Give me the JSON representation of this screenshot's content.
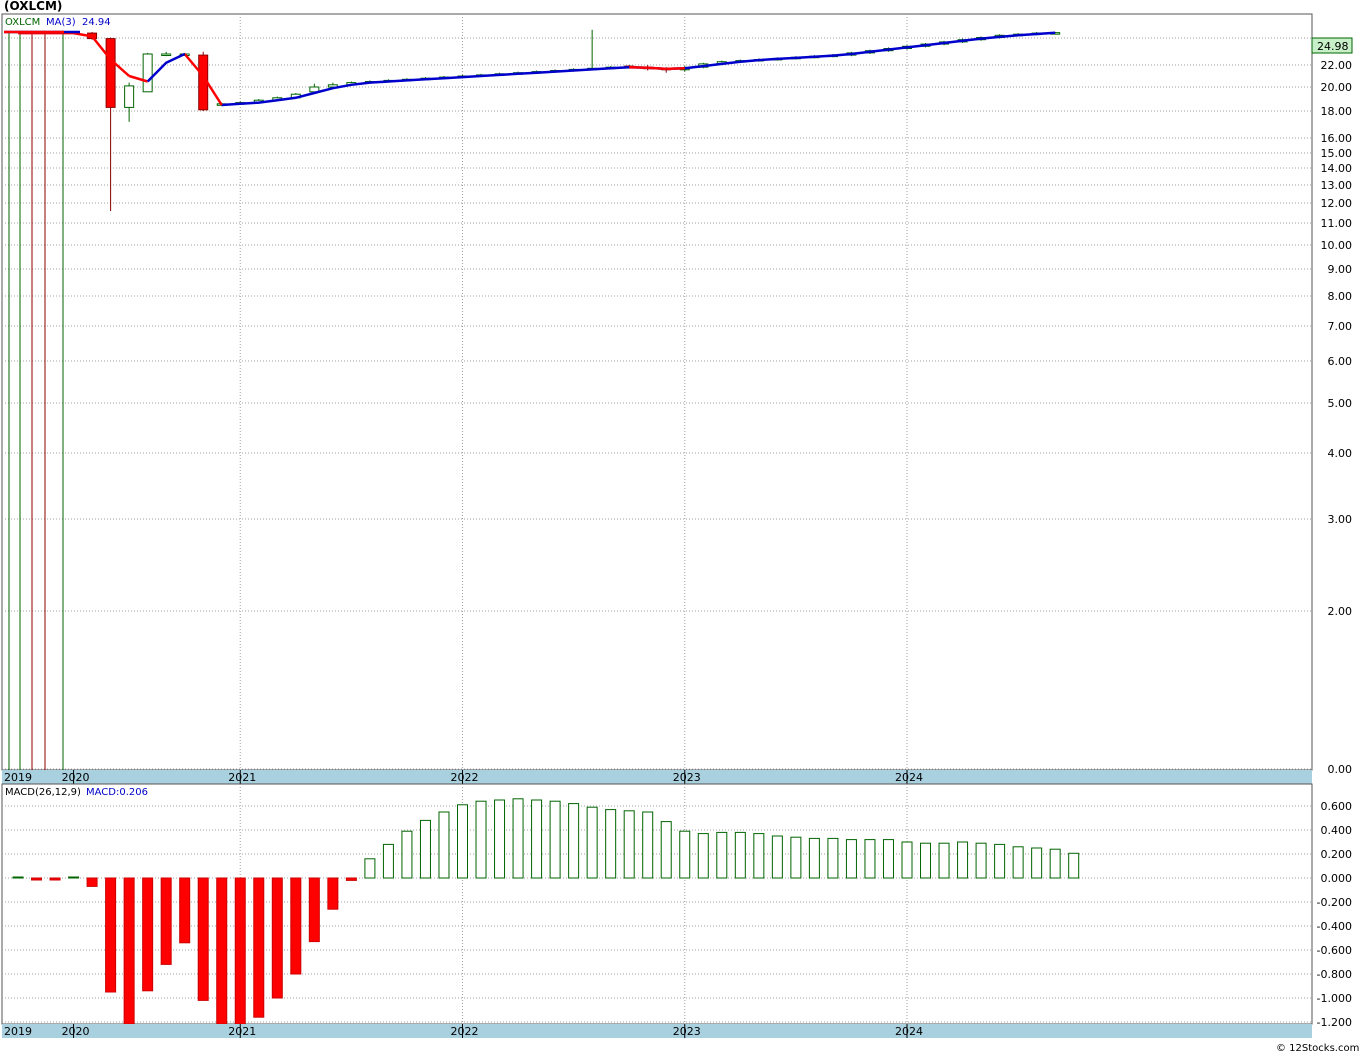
{
  "title": "(OXLCM)",
  "footer": "© 12Stocks.com",
  "chart_data": [
    {
      "type": "candlestick",
      "panel": "price",
      "symbol_label": "OXLCM",
      "ma_label": "MA(3)",
      "ma_value_label": "24.94",
      "last_price_label": "24.98",
      "y_scale": "log",
      "ylim": [
        0,
        25
      ],
      "y_ticks": [
        "22.00",
        "20.00",
        "18.00",
        "16.00",
        "15.00",
        "14.00",
        "13.00",
        "12.00",
        "11.00",
        "10.00",
        "9.00",
        "8.00",
        "7.00",
        "6.00",
        "5.00",
        "4.00",
        "3.00",
        "2.00",
        "0.00"
      ],
      "x_labels": [
        "2019",
        "2020",
        "2021",
        "2022",
        "2023",
        "2024"
      ],
      "x_label_months": [
        0,
        3,
        12,
        24,
        36,
        48
      ],
      "grid": true,
      "colors": {
        "up": "#006400",
        "down": "#ff0000",
        "ma_up": "#0000cc",
        "ma_down": "#ff0000",
        "grid": "#a0a0a0",
        "axis_band": "#a9d0df",
        "last_price_box": "#c8f0c8"
      },
      "candles": [
        {
          "m": 0,
          "o": 24.9,
          "h": 25.0,
          "l": 24.8,
          "c": 24.9
        },
        {
          "m": 1,
          "o": 24.9,
          "h": 25.0,
          "l": 24.8,
          "c": 24.95
        },
        {
          "m": 2,
          "o": 24.9,
          "h": 25.0,
          "l": 24.8,
          "c": 24.9
        },
        {
          "m": 3,
          "o": 24.9,
          "h": 25.0,
          "l": 24.8,
          "c": 24.95
        },
        {
          "m": 4,
          "o": 24.9,
          "h": 25.0,
          "l": 24.3,
          "c": 24.4
        },
        {
          "m": 5,
          "o": 24.4,
          "h": 24.5,
          "l": 11.6,
          "c": 18.3
        },
        {
          "m": 6,
          "o": 18.3,
          "h": 20.4,
          "l": 17.2,
          "c": 20.1
        },
        {
          "m": 7,
          "o": 19.6,
          "h": 23.1,
          "l": 19.6,
          "c": 23.0
        },
        {
          "m": 8,
          "o": 23.0,
          "h": 23.2,
          "l": 22.8,
          "c": 23.0
        },
        {
          "m": 9,
          "o": 23.0,
          "h": 23.1,
          "l": 22.9,
          "c": 23.0
        },
        {
          "m": 10,
          "o": 22.9,
          "h": 23.2,
          "l": 18.0,
          "c": 18.1
        },
        {
          "m": 11,
          "o": 18.5,
          "h": 18.7,
          "l": 18.4,
          "c": 18.6
        },
        {
          "m": 12,
          "o": 18.6,
          "h": 18.8,
          "l": 18.5,
          "c": 18.7
        },
        {
          "m": 13,
          "o": 18.7,
          "h": 19.0,
          "l": 18.6,
          "c": 18.9
        },
        {
          "m": 14,
          "o": 18.9,
          "h": 19.2,
          "l": 18.8,
          "c": 19.1
        },
        {
          "m": 15,
          "o": 19.1,
          "h": 19.5,
          "l": 19.0,
          "c": 19.4
        },
        {
          "m": 16,
          "o": 19.6,
          "h": 20.3,
          "l": 19.5,
          "c": 20.0
        },
        {
          "m": 17,
          "o": 20.0,
          "h": 20.4,
          "l": 19.9,
          "c": 20.2
        },
        {
          "m": 18,
          "o": 20.2,
          "h": 20.5,
          "l": 20.1,
          "c": 20.4
        },
        {
          "m": 19,
          "o": 20.4,
          "h": 20.6,
          "l": 20.3,
          "c": 20.5
        },
        {
          "m": 20,
          "o": 20.5,
          "h": 20.7,
          "l": 20.4,
          "c": 20.6
        },
        {
          "m": 21,
          "o": 20.6,
          "h": 20.8,
          "l": 20.5,
          "c": 20.7
        },
        {
          "m": 22,
          "o": 20.7,
          "h": 20.9,
          "l": 20.6,
          "c": 20.8
        },
        {
          "m": 23,
          "o": 20.8,
          "h": 21.0,
          "l": 20.7,
          "c": 20.9
        },
        {
          "m": 24,
          "o": 20.9,
          "h": 21.1,
          "l": 20.8,
          "c": 21.0
        },
        {
          "m": 25,
          "o": 21.0,
          "h": 21.2,
          "l": 20.9,
          "c": 21.1
        },
        {
          "m": 26,
          "o": 21.1,
          "h": 21.3,
          "l": 21.0,
          "c": 21.2
        },
        {
          "m": 27,
          "o": 21.2,
          "h": 21.4,
          "l": 21.1,
          "c": 21.3
        },
        {
          "m": 28,
          "o": 21.3,
          "h": 21.5,
          "l": 21.2,
          "c": 21.4
        },
        {
          "m": 29,
          "o": 21.4,
          "h": 21.6,
          "l": 21.3,
          "c": 21.5
        },
        {
          "m": 30,
          "o": 21.5,
          "h": 21.7,
          "l": 21.4,
          "c": 21.6
        },
        {
          "m": 31,
          "o": 21.6,
          "h": 25.2,
          "l": 21.5,
          "c": 21.7
        },
        {
          "m": 32,
          "o": 21.7,
          "h": 21.9,
          "l": 21.6,
          "c": 21.8
        },
        {
          "m": 33,
          "o": 21.9,
          "h": 22.0,
          "l": 21.7,
          "c": 21.8
        },
        {
          "m": 34,
          "o": 21.8,
          "h": 22.0,
          "l": 21.5,
          "c": 21.7
        },
        {
          "m": 35,
          "o": 21.7,
          "h": 21.8,
          "l": 21.3,
          "c": 21.6
        },
        {
          "m": 36,
          "o": 21.6,
          "h": 21.9,
          "l": 21.4,
          "c": 21.7
        },
        {
          "m": 37,
          "o": 21.8,
          "h": 22.2,
          "l": 21.7,
          "c": 22.1
        },
        {
          "m": 38,
          "o": 22.1,
          "h": 22.4,
          "l": 22.0,
          "c": 22.3
        },
        {
          "m": 39,
          "o": 22.3,
          "h": 22.5,
          "l": 22.2,
          "c": 22.4
        },
        {
          "m": 40,
          "o": 22.4,
          "h": 22.6,
          "l": 22.3,
          "c": 22.5
        },
        {
          "m": 41,
          "o": 22.5,
          "h": 22.7,
          "l": 22.4,
          "c": 22.6
        },
        {
          "m": 42,
          "o": 22.6,
          "h": 22.8,
          "l": 22.5,
          "c": 22.7
        },
        {
          "m": 43,
          "o": 22.7,
          "h": 22.9,
          "l": 22.6,
          "c": 22.8
        },
        {
          "m": 44,
          "o": 22.8,
          "h": 23.0,
          "l": 22.7,
          "c": 22.9
        },
        {
          "m": 45,
          "o": 22.9,
          "h": 23.2,
          "l": 22.8,
          "c": 23.1
        },
        {
          "m": 46,
          "o": 23.1,
          "h": 23.4,
          "l": 23.0,
          "c": 23.3
        },
        {
          "m": 47,
          "o": 23.3,
          "h": 23.6,
          "l": 23.2,
          "c": 23.5
        },
        {
          "m": 48,
          "o": 23.5,
          "h": 23.8,
          "l": 23.4,
          "c": 23.7
        },
        {
          "m": 49,
          "o": 23.7,
          "h": 24.0,
          "l": 23.6,
          "c": 23.9
        },
        {
          "m": 50,
          "o": 23.9,
          "h": 24.2,
          "l": 23.8,
          "c": 24.1
        },
        {
          "m": 51,
          "o": 24.1,
          "h": 24.4,
          "l": 24.0,
          "c": 24.3
        },
        {
          "m": 52,
          "o": 24.3,
          "h": 24.6,
          "l": 24.2,
          "c": 24.5
        },
        {
          "m": 53,
          "o": 24.5,
          "h": 24.8,
          "l": 24.4,
          "c": 24.7
        },
        {
          "m": 54,
          "o": 24.7,
          "h": 24.9,
          "l": 24.6,
          "c": 24.8
        },
        {
          "m": 55,
          "o": 24.8,
          "h": 25.0,
          "l": 24.7,
          "c": 24.9
        },
        {
          "m": 56,
          "o": 24.9,
          "h": 25.0,
          "l": 24.8,
          "c": 24.94
        }
      ],
      "ma": [
        {
          "m": 0,
          "v": 24.9
        },
        {
          "m": 1,
          "v": 24.9
        },
        {
          "m": 2,
          "v": 24.9
        },
        {
          "m": 3,
          "v": 24.9
        },
        {
          "m": 4,
          "v": 24.6
        },
        {
          "m": 5,
          "v": 22.5
        },
        {
          "m": 6,
          "v": 21.0
        },
        {
          "m": 7,
          "v": 20.5
        },
        {
          "m": 8,
          "v": 22.2
        },
        {
          "m": 9,
          "v": 23.0
        },
        {
          "m": 10,
          "v": 21.0
        },
        {
          "m": 11,
          "v": 18.5
        },
        {
          "m": 12,
          "v": 18.6
        },
        {
          "m": 13,
          "v": 18.7
        },
        {
          "m": 14,
          "v": 18.9
        },
        {
          "m": 15,
          "v": 19.1
        },
        {
          "m": 16,
          "v": 19.5
        },
        {
          "m": 17,
          "v": 19.9
        },
        {
          "m": 18,
          "v": 20.2
        },
        {
          "m": 19,
          "v": 20.4
        },
        {
          "m": 20,
          "v": 20.5
        },
        {
          "m": 21,
          "v": 20.6
        },
        {
          "m": 22,
          "v": 20.7
        },
        {
          "m": 23,
          "v": 20.8
        },
        {
          "m": 24,
          "v": 20.9
        },
        {
          "m": 25,
          "v": 21.0
        },
        {
          "m": 26,
          "v": 21.1
        },
        {
          "m": 27,
          "v": 21.2
        },
        {
          "m": 28,
          "v": 21.3
        },
        {
          "m": 29,
          "v": 21.4
        },
        {
          "m": 30,
          "v": 21.5
        },
        {
          "m": 31,
          "v": 21.6
        },
        {
          "m": 32,
          "v": 21.7
        },
        {
          "m": 33,
          "v": 21.8
        },
        {
          "m": 34,
          "v": 21.75
        },
        {
          "m": 35,
          "v": 21.65
        },
        {
          "m": 36,
          "v": 21.7
        },
        {
          "m": 37,
          "v": 21.9
        },
        {
          "m": 38,
          "v": 22.1
        },
        {
          "m": 39,
          "v": 22.3
        },
        {
          "m": 40,
          "v": 22.45
        },
        {
          "m": 41,
          "v": 22.55
        },
        {
          "m": 42,
          "v": 22.65
        },
        {
          "m": 43,
          "v": 22.75
        },
        {
          "m": 44,
          "v": 22.85
        },
        {
          "m": 45,
          "v": 23.0
        },
        {
          "m": 46,
          "v": 23.2
        },
        {
          "m": 47,
          "v": 23.4
        },
        {
          "m": 48,
          "v": 23.6
        },
        {
          "m": 49,
          "v": 23.8
        },
        {
          "m": 50,
          "v": 24.0
        },
        {
          "m": 51,
          "v": 24.2
        },
        {
          "m": 52,
          "v": 24.4
        },
        {
          "m": 53,
          "v": 24.55
        },
        {
          "m": 54,
          "v": 24.7
        },
        {
          "m": 55,
          "v": 24.82
        },
        {
          "m": 56,
          "v": 24.94
        }
      ]
    },
    {
      "type": "bar",
      "panel": "macd",
      "label": "MACD(26,12,9)",
      "value_label": "MACD:0.206",
      "ylim": [
        -1.26,
        0.66
      ],
      "y_ticks": [
        "0.600",
        "0.400",
        "0.200",
        "0.000",
        "-0.200",
        "-0.400",
        "-0.600",
        "-0.800",
        "-1.000",
        "-1.200"
      ],
      "x_labels": [
        "2019",
        "2020",
        "2021",
        "2022",
        "2023",
        "2024"
      ],
      "x_label_months": [
        0,
        3,
        12,
        24,
        36,
        48
      ],
      "colors": {
        "positive": "#006400",
        "negative": "#ff0000"
      },
      "bars": [
        {
          "m": 0,
          "v": 0.0
        },
        {
          "m": 1,
          "v": -0.008
        },
        {
          "m": 2,
          "v": -0.01
        },
        {
          "m": 3,
          "v": 0.0
        },
        {
          "m": 4,
          "v": -0.07
        },
        {
          "m": 5,
          "v": -0.95
        },
        {
          "m": 6,
          "v": -1.24
        },
        {
          "m": 7,
          "v": -0.94
        },
        {
          "m": 8,
          "v": -0.72
        },
        {
          "m": 9,
          "v": -0.54
        },
        {
          "m": 10,
          "v": -1.02
        },
        {
          "m": 11,
          "v": -1.22
        },
        {
          "m": 12,
          "v": -1.24
        },
        {
          "m": 13,
          "v": -1.16
        },
        {
          "m": 14,
          "v": -1.0
        },
        {
          "m": 15,
          "v": -0.8
        },
        {
          "m": 16,
          "v": -0.53
        },
        {
          "m": 17,
          "v": -0.26
        },
        {
          "m": 18,
          "v": -0.02
        },
        {
          "m": 19,
          "v": 0.16
        },
        {
          "m": 20,
          "v": 0.28
        },
        {
          "m": 21,
          "v": 0.39
        },
        {
          "m": 22,
          "v": 0.48
        },
        {
          "m": 23,
          "v": 0.55
        },
        {
          "m": 24,
          "v": 0.61
        },
        {
          "m": 25,
          "v": 0.64
        },
        {
          "m": 26,
          "v": 0.65
        },
        {
          "m": 27,
          "v": 0.66
        },
        {
          "m": 28,
          "v": 0.65
        },
        {
          "m": 29,
          "v": 0.64
        },
        {
          "m": 30,
          "v": 0.62
        },
        {
          "m": 31,
          "v": 0.59
        },
        {
          "m": 32,
          "v": 0.57
        },
        {
          "m": 33,
          "v": 0.56
        },
        {
          "m": 34,
          "v": 0.55
        },
        {
          "m": 35,
          "v": 0.47
        },
        {
          "m": 36,
          "v": 0.39
        },
        {
          "m": 37,
          "v": 0.37
        },
        {
          "m": 38,
          "v": 0.38
        },
        {
          "m": 39,
          "v": 0.38
        },
        {
          "m": 40,
          "v": 0.37
        },
        {
          "m": 41,
          "v": 0.35
        },
        {
          "m": 42,
          "v": 0.34
        },
        {
          "m": 43,
          "v": 0.33
        },
        {
          "m": 44,
          "v": 0.33
        },
        {
          "m": 45,
          "v": 0.32
        },
        {
          "m": 46,
          "v": 0.32
        },
        {
          "m": 47,
          "v": 0.32
        },
        {
          "m": 48,
          "v": 0.3
        },
        {
          "m": 49,
          "v": 0.29
        },
        {
          "m": 50,
          "v": 0.29
        },
        {
          "m": 51,
          "v": 0.3
        },
        {
          "m": 52,
          "v": 0.29
        },
        {
          "m": 53,
          "v": 0.28
        },
        {
          "m": 54,
          "v": 0.26
        },
        {
          "m": 55,
          "v": 0.25
        },
        {
          "m": 56,
          "v": 0.24
        },
        {
          "m": 57,
          "v": 0.206
        }
      ]
    }
  ]
}
